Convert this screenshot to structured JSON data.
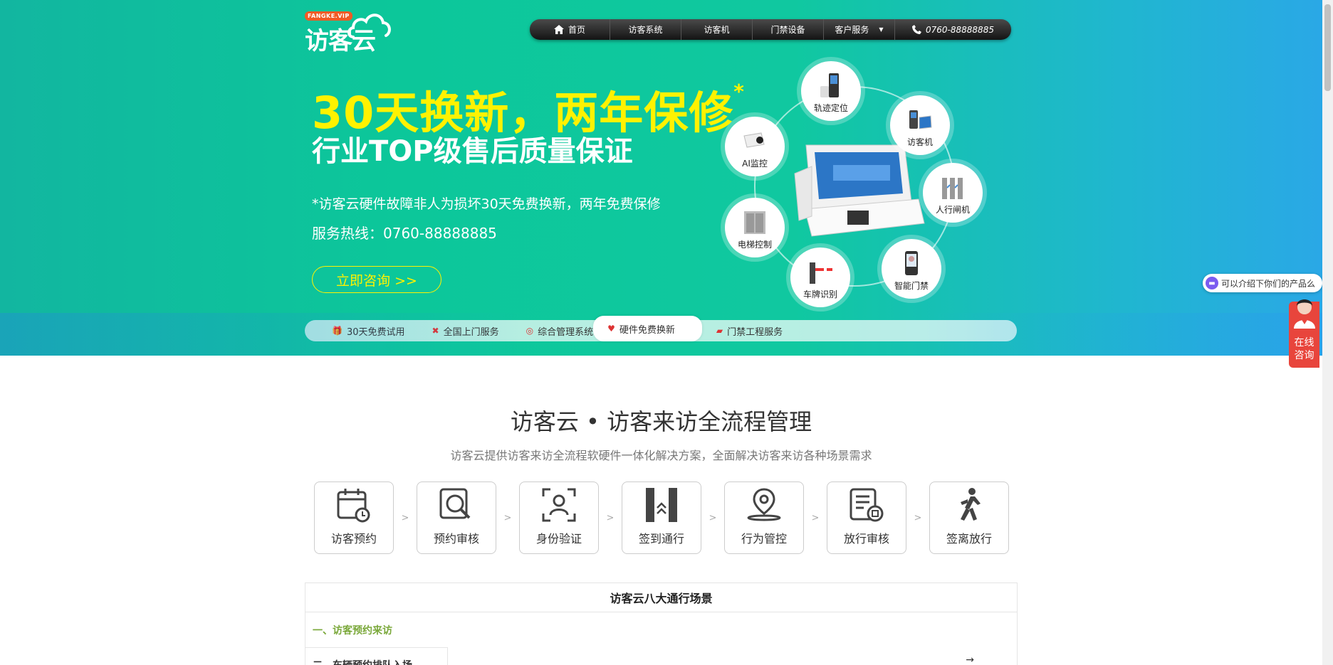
{
  "logo": {
    "badge": "FANGKE.VIP",
    "text": "访客云"
  },
  "nav": {
    "items": [
      {
        "label": "首页"
      },
      {
        "label": "访客系统"
      },
      {
        "label": "访客机"
      },
      {
        "label": "门禁设备"
      },
      {
        "label": "客户服务"
      },
      {
        "label": "0760-88888885"
      }
    ]
  },
  "hero": {
    "headline1": "30天换新，两年保修",
    "headline1_mark": "*",
    "headline2": "行业TOP级售后质量保证",
    "desc": "*访客云硬件故障非人为损坏30天免费换新，两年免费保修",
    "hotline": "服务热线：0760-88888885",
    "cta": "立即咨询 >>"
  },
  "ring": {
    "nodes": [
      {
        "label": "轨迹定位"
      },
      {
        "label": "访客机"
      },
      {
        "label": "人行闸机"
      },
      {
        "label": "智能门禁"
      },
      {
        "label": "车牌识别"
      },
      {
        "label": "电梯控制"
      },
      {
        "label": "AI监控"
      }
    ]
  },
  "features": [
    {
      "label": "30天免费试用"
    },
    {
      "label": "全国上门服务"
    },
    {
      "label": "综合管理系统"
    },
    {
      "label": "硬件免费换新"
    },
    {
      "label": "门禁工程服务"
    }
  ],
  "section": {
    "title": "访客云 • 访客来访全流程管理",
    "subtitle": "访客云提供访客来访全流程软硬件一体化解决方案，全面解决访客来访各种场景需求"
  },
  "steps": [
    {
      "label": "访客预约"
    },
    {
      "label": "预约审核"
    },
    {
      "label": "身份验证"
    },
    {
      "label": "签到通行"
    },
    {
      "label": "行为管控"
    },
    {
      "label": "放行审核"
    },
    {
      "label": "签离放行"
    }
  ],
  "step_separator": ">",
  "scenes": {
    "title": "访客云八大通行场景",
    "item1": "一、访客预约来访",
    "item2": "二、车辆预约排队入场",
    "arrow": "→"
  },
  "chat": {
    "bubble": "可以介绍下你们的产品么",
    "consult": "在线咨询",
    "consult_line1": "在线",
    "consult_line2": "咨询"
  }
}
